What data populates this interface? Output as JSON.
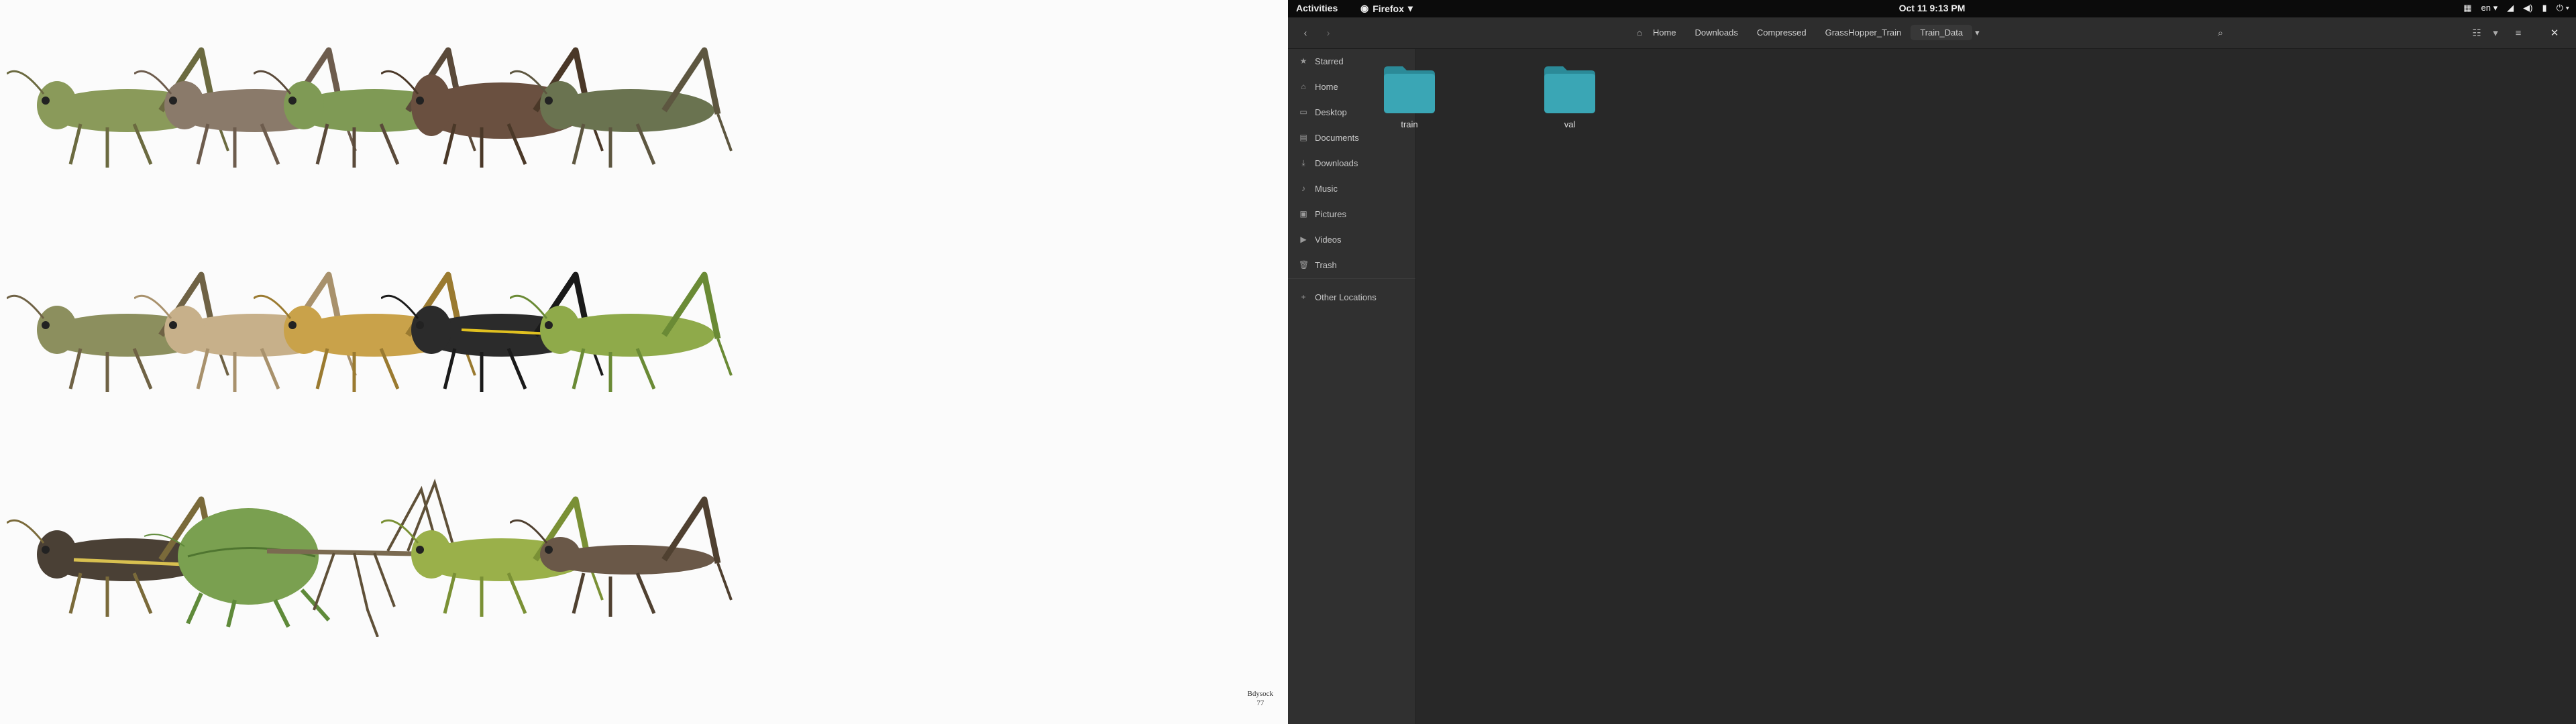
{
  "gallery": {
    "watermark_line1": "Bdysock",
    "watermark_line2": "77",
    "images": [
      {
        "name": "grasshopper-1",
        "body": "#8a9a5a",
        "legs": "#6b6a40"
      },
      {
        "name": "grasshopper-2",
        "body": "#8a7a6a",
        "legs": "#6d5c4d"
      },
      {
        "name": "grasshopper-3",
        "body": "#7f9a55",
        "legs": "#5a4a3a"
      },
      {
        "name": "grasshopper-4",
        "body": "#6a5040",
        "legs": "#4a3828"
      },
      {
        "name": "grasshopper-5",
        "body": "#6a7350",
        "legs": "#5d5640"
      },
      {
        "name": "grasshopper-6",
        "body": "#8c8f5e",
        "legs": "#6f6245"
      },
      {
        "name": "grasshopper-7",
        "body": "#c7b08a",
        "legs": "#a8916c"
      },
      {
        "name": "grasshopper-8",
        "body": "#c9a24a",
        "legs": "#9a7a30"
      },
      {
        "name": "grasshopper-9",
        "body": "#2b2b2b",
        "legs": "#1a1a1a"
      },
      {
        "name": "grasshopper-10",
        "body": "#8faa4a",
        "legs": "#6a8a35"
      },
      {
        "name": "grasshopper-11",
        "body": "#4a4035",
        "legs": "#7a6a3a"
      },
      {
        "name": "grasshopper-12",
        "body": "#7aa050",
        "legs": "#5f8a3a"
      },
      {
        "name": "grasshopper-13",
        "body": "#7a6a50",
        "legs": "#5f5038"
      },
      {
        "name": "grasshopper-14",
        "body": "#9ab04a",
        "legs": "#7a9035"
      },
      {
        "name": "grasshopper-15",
        "body": "#6a5848",
        "legs": "#4f4030"
      }
    ]
  },
  "topbar": {
    "activities": "Activities",
    "app_name": "Firefox",
    "clock": "Oct 11  9:13 PM",
    "language": "en"
  },
  "files": {
    "breadcrumbs": [
      "Home",
      "Downloads",
      "Compressed",
      "GrassHopper_Train",
      "Train_Data"
    ],
    "sidebar": [
      {
        "label": "Starred",
        "icon": "star-icon"
      },
      {
        "label": "Home",
        "icon": "home-icon"
      },
      {
        "label": "Desktop",
        "icon": "desktop-icon"
      },
      {
        "label": "Documents",
        "icon": "documents-icon"
      },
      {
        "label": "Downloads",
        "icon": "download-icon"
      },
      {
        "label": "Music",
        "icon": "music-icon"
      },
      {
        "label": "Pictures",
        "icon": "pictures-icon"
      },
      {
        "label": "Videos",
        "icon": "videos-icon"
      },
      {
        "label": "Trash",
        "icon": "trash-icon"
      },
      {
        "label": "Other Locations",
        "icon": "plus-icon"
      }
    ],
    "folders": [
      {
        "label": "train"
      },
      {
        "label": "val"
      }
    ],
    "folder_color": "#3aa6b5"
  }
}
